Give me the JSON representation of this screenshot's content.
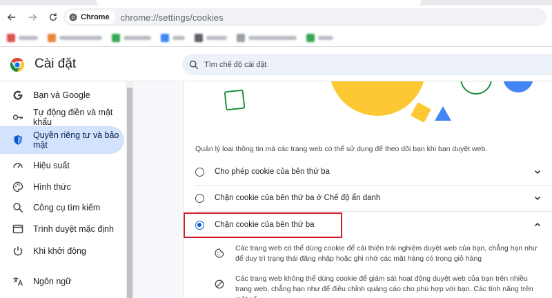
{
  "browser": {
    "chip_label": "Chrome",
    "url": "chrome://settings/cookies"
  },
  "bookmarks": [
    {
      "color": "#d9534f",
      "width": 28
    },
    {
      "color": "#e8833a",
      "width": 62
    },
    {
      "color": "#34a853",
      "width": 40
    },
    {
      "color": "#4285f4",
      "width": 18
    },
    {
      "color": "#5f6368",
      "width": 30
    },
    {
      "color": "#9aa0a6",
      "width": 70
    },
    {
      "color": "#34a853",
      "width": 22
    }
  ],
  "settings": {
    "title": "Cài đặt",
    "search_placeholder": "Tìm chế độ cài đặt"
  },
  "sidebar": {
    "items": [
      {
        "label": "Bạn và Google",
        "icon": "google-g-icon"
      },
      {
        "label": "Tự động điền và mật khẩu",
        "icon": "key-icon"
      },
      {
        "label": "Quyền riêng tư và bảo mật",
        "icon": "shield-icon",
        "active": true
      },
      {
        "label": "Hiệu suất",
        "icon": "speedometer-icon"
      },
      {
        "label": "Hình thức",
        "icon": "palette-icon"
      },
      {
        "label": "Công cụ tìm kiếm",
        "icon": "search-icon"
      },
      {
        "label": "Trình duyệt mặc định",
        "icon": "browser-window-icon"
      },
      {
        "label": "Khi khởi động",
        "icon": "power-icon"
      },
      {
        "label": "Ngôn ngữ",
        "icon": "translate-icon"
      }
    ]
  },
  "cookies": {
    "description": "Quản lý loại thông tin mà các trang web có thể sử dụng để theo dõi bạn khi bạn duyệt web.",
    "options": [
      {
        "label": "Cho phép cookie của bên thứ ba",
        "selected": false,
        "expanded": false
      },
      {
        "label": "Chặn cookie của bên thứ ba ở Chế độ ẩn danh",
        "selected": false,
        "expanded": false
      },
      {
        "label": "Chặn cookie của bên thứ ba",
        "selected": true,
        "expanded": true
      }
    ],
    "details": [
      {
        "icon": "cookie-icon",
        "text": "Các trang web có thể dùng cookie để cải thiện trải nghiệm duyệt web của bạn, chẳng hạn như để duy trì trạng thái đăng nhập hoặc ghi nhớ các mặt hàng có trong giỏ hàng"
      },
      {
        "icon": "block-icon",
        "text": "Các trang web không thể dùng cookie để giám sát hoạt động duyệt web của bạn trên nhiều trang web, chẳng hạn như để điều chỉnh quảng cáo cho phù hợp với bạn. Các tính năng trên một số"
      }
    ]
  },
  "colors": {
    "accent": "#0b57d0",
    "active_nav_bg": "#d3e3fd",
    "highlight_border": "#d32026",
    "illustration_yellow": "#fcc934",
    "illustration_green": "#1e8e3e",
    "illustration_blue": "#4285f4"
  }
}
